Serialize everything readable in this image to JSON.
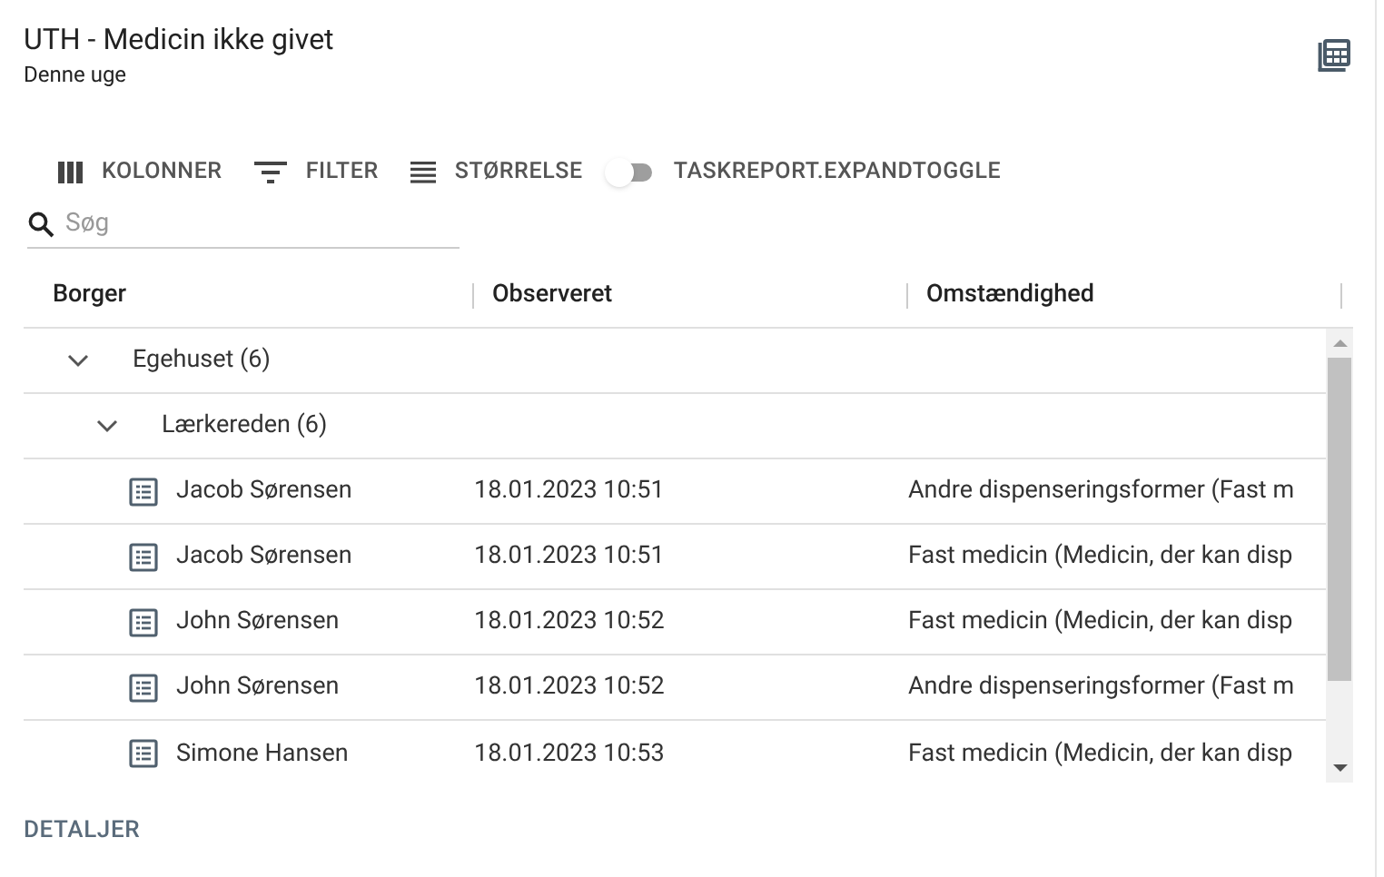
{
  "header": {
    "title": "UTH - Medicin ikke givet",
    "subtitle": "Denne uge"
  },
  "toolbar": {
    "buttons": [
      {
        "kind": "columns",
        "label": "KOLONNER"
      },
      {
        "kind": "filter",
        "label": "FILTER"
      },
      {
        "kind": "density",
        "label": "STØRRELSE"
      }
    ],
    "toggle": {
      "label": "TASKREPORT.EXPANDTOGGLE",
      "on": false
    }
  },
  "search": {
    "placeholder": "Søg"
  },
  "table": {
    "columns": [
      "Borger",
      "Observeret",
      "Omstændighed"
    ],
    "groups": [
      {
        "label": "Egehuset (6)",
        "expanded": true,
        "children": [
          {
            "label": "Lærkereden (6)",
            "expanded": true,
            "rows": [
              {
                "borger": "Jacob Sørensen",
                "observeret": "18.01.2023 10:51",
                "omstaendighed": "Andre dispenseringsformer (Fast m"
              },
              {
                "borger": "Jacob Sørensen",
                "observeret": "18.01.2023 10:51",
                "omstaendighed": "Fast medicin (Medicin, der kan disp"
              },
              {
                "borger": "John Sørensen",
                "observeret": "18.01.2023 10:52",
                "omstaendighed": "Fast medicin (Medicin, der kan disp"
              },
              {
                "borger": "John Sørensen",
                "observeret": "18.01.2023 10:52",
                "omstaendighed": "Andre dispenseringsformer (Fast m"
              },
              {
                "borger": "Simone Hansen",
                "observeret": "18.01.2023 10:53",
                "omstaendighed": "Fast medicin (Medicin, der kan disp"
              }
            ]
          }
        ]
      }
    ]
  },
  "footer": {
    "link": "DETALJER"
  }
}
